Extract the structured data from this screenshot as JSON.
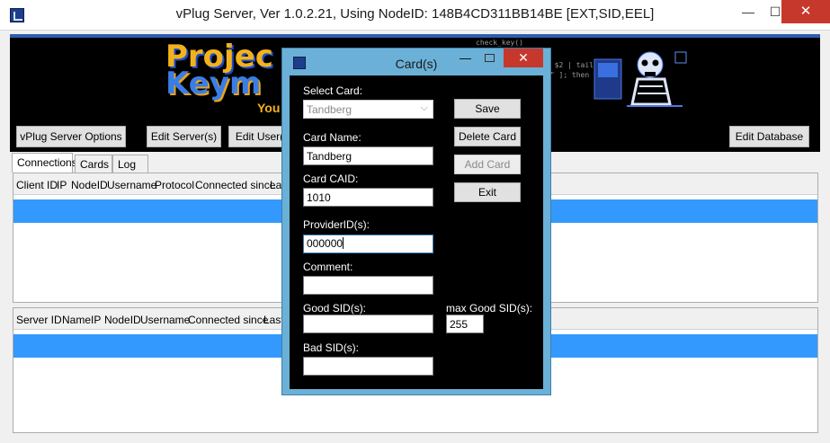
{
  "window": {
    "title": "vPlug Server,  Ver 1.0.2.21, Using NodeID: 148B4CD311BB14BE [EXT,SID,EEL]",
    "minimize": "—",
    "maximize": "☐",
    "close": "✕"
  },
  "banner": {
    "logo_line1": "Projec",
    "logo_line2": "Keym",
    "logo_sub": "You",
    "code_snippet": [
      "check_key()",
      "\" $2 | tail -1\"",
      "\"\" ]; then",
      "/"
    ]
  },
  "toolbar": {
    "server_options": "vPlug Server Options",
    "edit_servers": "Edit Server(s)",
    "edit_users": "Edit User(",
    "edit_database": "Edit Database"
  },
  "tabs": [
    "Connections",
    "Cards",
    "Log"
  ],
  "clients_grid": {
    "columns": [
      "Client ID",
      "IP",
      "NodeID",
      "Username",
      "Protocol",
      "Connected since",
      "Las"
    ]
  },
  "servers_grid": {
    "columns": [
      "Server ID",
      "Name",
      "IP",
      "NodeID",
      "Username",
      "Connected since",
      "Last"
    ]
  },
  "dialog": {
    "title": "Card(s)",
    "min": "—",
    "max": "",
    "close": "✕",
    "select_card_label": "Select Card:",
    "select_card_value": "Tandberg",
    "card_name_label": "Card Name:",
    "card_name_value": "Tandberg",
    "card_caid_label": "Card CAID:",
    "card_caid_value": "1010",
    "provider_label": "ProviderID(s):",
    "provider_value": "000000",
    "comment_label": "Comment:",
    "comment_value": "",
    "good_sid_label": "Good SID(s):",
    "good_sid_value": "",
    "max_good_sid_label": "max Good SID(s):",
    "max_good_sid_value": "255",
    "bad_sid_label": "Bad SID(s):",
    "bad_sid_value": "",
    "save": "Save",
    "delete_card": "Delete Card",
    "add_card": "Add Card",
    "exit": "Exit"
  },
  "colors": {
    "selection": "#3399ff",
    "banner_accent": "#2f5cb0",
    "dialog_frame": "#6bb0d6",
    "close_red": "#c7382c"
  }
}
